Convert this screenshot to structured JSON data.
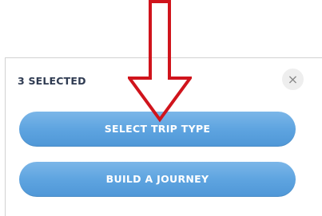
{
  "panel": {
    "selected_count": "3 SELECTED",
    "close_label": "×"
  },
  "actions": {
    "select_trip_type": "SELECT TRIP TYPE",
    "build_a_journey": "BUILD A JOURNEY"
  },
  "annotation": {
    "icon": "down-arrow-icon",
    "color": "#d0141c"
  },
  "colors": {
    "button_bg": "#5ea4e0",
    "button_text": "#ffffff",
    "close_bg": "#eeeeee",
    "heading_text": "#2f3b52"
  }
}
